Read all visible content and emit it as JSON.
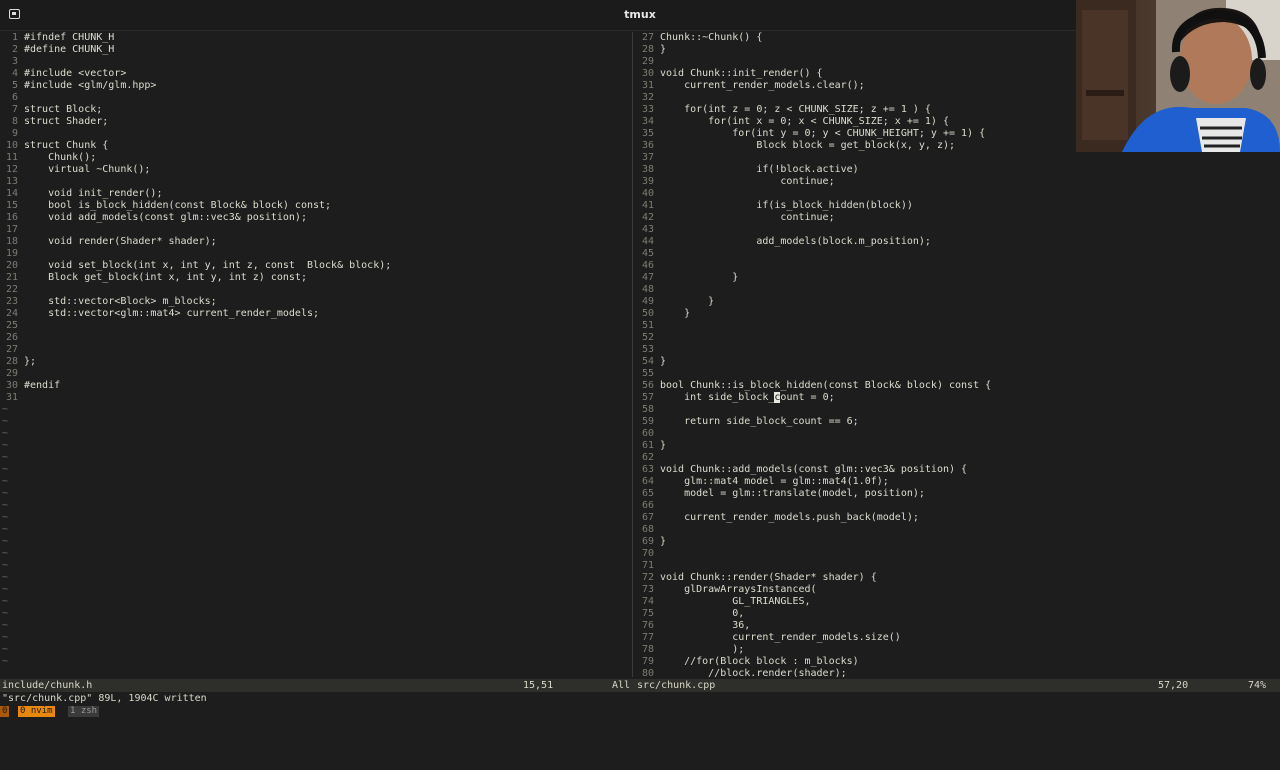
{
  "window": {
    "title": "tmux"
  },
  "left_pane": {
    "lines": [
      {
        "n": "1",
        "t": "#ifndef CHUNK_H"
      },
      {
        "n": "2",
        "t": "#define CHUNK_H"
      },
      {
        "n": "3",
        "t": ""
      },
      {
        "n": "4",
        "t": "#include <vector>"
      },
      {
        "n": "5",
        "t": "#include <glm/glm.hpp>"
      },
      {
        "n": "6",
        "t": ""
      },
      {
        "n": "7",
        "t": "struct Block;"
      },
      {
        "n": "8",
        "t": "struct Shader;"
      },
      {
        "n": "9",
        "t": ""
      },
      {
        "n": "10",
        "t": "struct Chunk {"
      },
      {
        "n": "11",
        "t": "    Chunk();"
      },
      {
        "n": "12",
        "t": "    virtual ~Chunk();"
      },
      {
        "n": "13",
        "t": ""
      },
      {
        "n": "14",
        "t": "    void init_render();"
      },
      {
        "n": "15",
        "t": "    bool is_block_hidden(const Block& block) const;"
      },
      {
        "n": "16",
        "t": "    void add_models(const glm::vec3& position);"
      },
      {
        "n": "17",
        "t": ""
      },
      {
        "n": "18",
        "t": "    void render(Shader* shader);"
      },
      {
        "n": "19",
        "t": ""
      },
      {
        "n": "20",
        "t": "    void set_block(int x, int y, int z, const  Block& block);"
      },
      {
        "n": "21",
        "t": "    Block get_block(int x, int y, int z) const;"
      },
      {
        "n": "22",
        "t": ""
      },
      {
        "n": "23",
        "t": "    std::vector<Block> m_blocks;"
      },
      {
        "n": "24",
        "t": "    std::vector<glm::mat4> current_render_models;"
      },
      {
        "n": "25",
        "t": ""
      },
      {
        "n": "26",
        "t": ""
      },
      {
        "n": "27",
        "t": ""
      },
      {
        "n": "28",
        "t": "};"
      },
      {
        "n": "29",
        "t": ""
      },
      {
        "n": "30",
        "t": "#endif"
      },
      {
        "n": "31",
        "t": ""
      }
    ],
    "tilde": "~"
  },
  "right_pane": {
    "lines": [
      {
        "n": "27",
        "t": "Chunk::~Chunk() {"
      },
      {
        "n": "28",
        "t": "}"
      },
      {
        "n": "29",
        "t": ""
      },
      {
        "n": "30",
        "t": "void Chunk::init_render() {"
      },
      {
        "n": "31",
        "t": "    current_render_models.clear();"
      },
      {
        "n": "32",
        "t": ""
      },
      {
        "n": "33",
        "t": "    for(int z = 0; z < CHUNK_SIZE; z += 1 ) {"
      },
      {
        "n": "34",
        "t": "        for(int x = 0; x < CHUNK_SIZE; x += 1) {"
      },
      {
        "n": "35",
        "t": "            for(int y = 0; y < CHUNK_HEIGHT; y += 1) {"
      },
      {
        "n": "36",
        "t": "                Block block = get_block(x, y, z);"
      },
      {
        "n": "37",
        "t": ""
      },
      {
        "n": "38",
        "t": "                if(!block.active)"
      },
      {
        "n": "39",
        "t": "                    continue;"
      },
      {
        "n": "40",
        "t": ""
      },
      {
        "n": "41",
        "t": "                if(is_block_hidden(block))"
      },
      {
        "n": "42",
        "t": "                    continue;"
      },
      {
        "n": "43",
        "t": ""
      },
      {
        "n": "44",
        "t": "                add_models(block.m_position);"
      },
      {
        "n": "45",
        "t": ""
      },
      {
        "n": "46",
        "t": ""
      },
      {
        "n": "47",
        "t": "            }"
      },
      {
        "n": "48",
        "t": ""
      },
      {
        "n": "49",
        "t": "        }"
      },
      {
        "n": "50",
        "t": "    }"
      },
      {
        "n": "51",
        "t": ""
      },
      {
        "n": "52",
        "t": ""
      },
      {
        "n": "53",
        "t": ""
      },
      {
        "n": "54",
        "t": "}"
      },
      {
        "n": "55",
        "t": ""
      },
      {
        "n": "56",
        "t": "bool Chunk::is_block_hidden(const Block& block) const {"
      },
      {
        "n": "57",
        "t": "    int side_block_count = 0;"
      },
      {
        "n": "58",
        "t": ""
      },
      {
        "n": "59",
        "t": "    return side_block_count == 6;"
      },
      {
        "n": "60",
        "t": ""
      },
      {
        "n": "61",
        "t": "}"
      },
      {
        "n": "62",
        "t": ""
      },
      {
        "n": "63",
        "t": "void Chunk::add_models(const glm::vec3& position) {"
      },
      {
        "n": "64",
        "t": "    glm::mat4 model = glm::mat4(1.0f);"
      },
      {
        "n": "65",
        "t": "    model = glm::translate(model, position);"
      },
      {
        "n": "66",
        "t": ""
      },
      {
        "n": "67",
        "t": "    current_render_models.push_back(model);"
      },
      {
        "n": "68",
        "t": ""
      },
      {
        "n": "69",
        "t": "}"
      },
      {
        "n": "70",
        "t": ""
      },
      {
        "n": "71",
        "t": ""
      },
      {
        "n": "72",
        "t": "void Chunk::render(Shader* shader) {"
      },
      {
        "n": "73",
        "t": "    glDrawArraysInstanced("
      },
      {
        "n": "74",
        "t": "            GL_TRIANGLES,"
      },
      {
        "n": "75",
        "t": "            0,"
      },
      {
        "n": "76",
        "t": "            36,"
      },
      {
        "n": "77",
        "t": "            current_render_models.size()"
      },
      {
        "n": "78",
        "t": "            );"
      },
      {
        "n": "79",
        "t": "    //for(Block block : m_blocks)"
      },
      {
        "n": "80",
        "t": "        //block.render(shader);"
      }
    ]
  },
  "statusline": {
    "left_file": "include/chunk.h",
    "left_pos": "15,51",
    "left_pct": "All",
    "right_file": "src/chunk.cpp",
    "right_pos": "57,20",
    "right_pct": "74%"
  },
  "message": "\"src/chunk.cpp\" 89L, 1904C written",
  "tmux": {
    "idx": "0",
    "active_window": "0 nvim",
    "inactive_window": "1 zsh"
  },
  "colors": {
    "background": "#1d1d1d",
    "tmux_active": "#e8880e"
  }
}
